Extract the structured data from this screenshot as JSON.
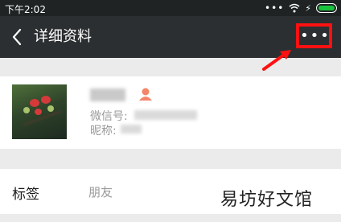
{
  "status_bar": {
    "time": "下午2:02",
    "dots": "•••"
  },
  "nav": {
    "title": "详细资料",
    "more_label": "•••"
  },
  "profile": {
    "wechat_id_label": "微信号:",
    "nickname_label": "昵称:"
  },
  "tag_row": {
    "label": "标签",
    "value": "朋友"
  },
  "watermark": "易坊好文馆",
  "colors": {
    "highlight": "#ff1111",
    "nav_bg": "#2c2f31",
    "status_bg": "#1f2324",
    "accent_gender": "#f3866a"
  },
  "icons": [
    "back-icon",
    "wifi-icon",
    "bolt-icon",
    "battery-icon",
    "more-icon",
    "arrow-icon",
    "gender-icon"
  ]
}
